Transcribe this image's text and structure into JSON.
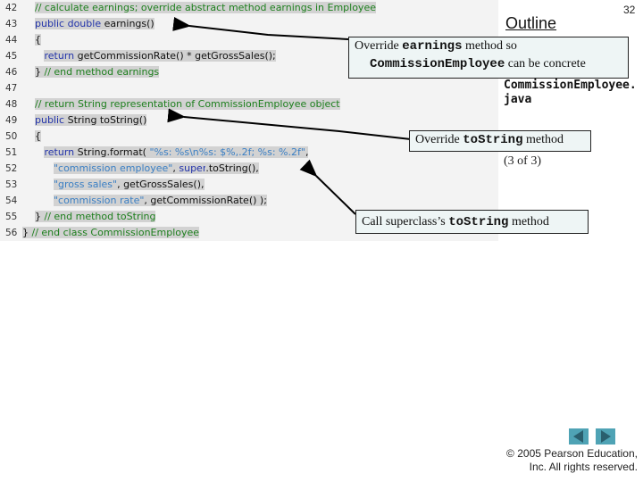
{
  "page": {
    "number": "32",
    "outline_label": "Outline",
    "file_name_line1": "CommissionEmployee.",
    "file_name_line2": "java",
    "slide_position": "(3 of 3)"
  },
  "code_lines": [
    {
      "num": "42",
      "parts": [
        {
          "t": "    "
        },
        {
          "c": "cm",
          "t": "// calculate earnings; override abstract method earnings in Employee"
        }
      ]
    },
    {
      "num": "43",
      "parts": [
        {
          "t": "    "
        },
        {
          "c": "kw",
          "t": "public double "
        },
        {
          "c": "tx",
          "t": "earnings()"
        }
      ]
    },
    {
      "num": "44",
      "parts": [
        {
          "t": "    "
        },
        {
          "c": "tx",
          "t": "{"
        }
      ]
    },
    {
      "num": "45",
      "parts": [
        {
          "t": "       "
        },
        {
          "c": "kw",
          "t": "return "
        },
        {
          "c": "tx",
          "t": "getCommissionRate() * getGrossSales();"
        }
      ]
    },
    {
      "num": "46",
      "parts": [
        {
          "t": "    "
        },
        {
          "c": "tx",
          "t": "} "
        },
        {
          "c": "cm",
          "t": "// end method earnings"
        }
      ]
    },
    {
      "num": "47",
      "parts": []
    },
    {
      "num": "48",
      "parts": [
        {
          "t": "    "
        },
        {
          "c": "cm",
          "t": "// return String representation of CommissionEmployee object"
        }
      ]
    },
    {
      "num": "49",
      "parts": [
        {
          "t": "    "
        },
        {
          "c": "kw",
          "t": "public "
        },
        {
          "c": "tx",
          "t": "String toString()"
        }
      ]
    },
    {
      "num": "50",
      "parts": [
        {
          "t": "    "
        },
        {
          "c": "tx",
          "t": "{"
        }
      ]
    },
    {
      "num": "51",
      "parts": [
        {
          "t": "       "
        },
        {
          "c": "kw",
          "t": "return "
        },
        {
          "c": "tx",
          "t": "String.format( "
        },
        {
          "c": "st",
          "t": "\"%s: %s\\n%s: $%,.2f; %s: %.2f\""
        },
        {
          "c": "tx",
          "t": ","
        }
      ]
    },
    {
      "num": "52",
      "parts": [
        {
          "t": "          "
        },
        {
          "c": "st",
          "t": "\"commission employee\""
        },
        {
          "c": "tx",
          "t": ", "
        },
        {
          "c": "kw",
          "t": "super"
        },
        {
          "c": "tx",
          "t": ".toString(),"
        }
      ]
    },
    {
      "num": "53",
      "parts": [
        {
          "t": "          "
        },
        {
          "c": "st",
          "t": "\"gross sales\""
        },
        {
          "c": "tx",
          "t": ", getGrossSales(),"
        }
      ]
    },
    {
      "num": "54",
      "parts": [
        {
          "t": "          "
        },
        {
          "c": "st",
          "t": "\"commission rate\""
        },
        {
          "c": "tx",
          "t": ", getCommissionRate() );"
        }
      ]
    },
    {
      "num": "55",
      "parts": [
        {
          "t": "    "
        },
        {
          "c": "tx",
          "t": "} "
        },
        {
          "c": "cm",
          "t": "// end method toString"
        }
      ]
    },
    {
      "num": "56",
      "parts": [
        {
          "c": "tx",
          "t": "} "
        },
        {
          "c": "cm",
          "t": "// end class CommissionEmployee"
        }
      ]
    }
  ],
  "callouts": {
    "earnings": {
      "pre": "Override ",
      "code": "earnings",
      "mid": " method so",
      "code2": "CommissionEmployee",
      "post": " can be concrete"
    },
    "tostring": {
      "pre": "Override ",
      "code": "toString",
      "post": " method"
    },
    "super": {
      "pre": "Call superclass’s ",
      "code": "toString",
      "post": " method"
    }
  },
  "navigation": {
    "prev_icon": "previous-arrow",
    "next_icon": "next-arrow"
  },
  "copyright": {
    "line1": "© 2005 Pearson Education,",
    "line2": "Inc.  All rights reserved."
  },
  "colors": {
    "keyword": "#2233aa",
    "comment": "#1d7f1d",
    "string": "#3a7fc4",
    "callout_bg": "#eef5f5",
    "nav": "#4fa3b5"
  }
}
